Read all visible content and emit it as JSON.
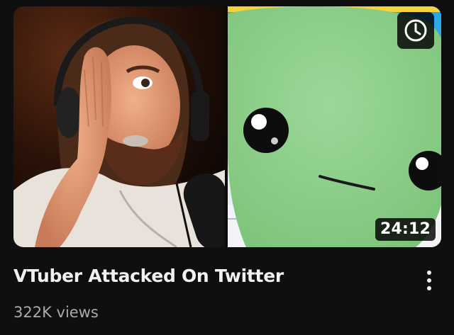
{
  "video": {
    "title": "VTuber Attacked On Twitter",
    "views": "322K views",
    "duration": "24:12"
  },
  "thumbnail": {
    "left_panel": "streamer facepalm webcam shot",
    "right_panel": "green cartoon vtuber character",
    "watch_later_icon": "clock-icon"
  },
  "actions": {
    "more_icon": "more-vert-icon"
  },
  "colors": {
    "background": "#0f0f0f",
    "title": "#f1f1f1",
    "meta": "#aaaaaa",
    "badge_bg": "#000000",
    "character_green": "#8ccf88"
  }
}
